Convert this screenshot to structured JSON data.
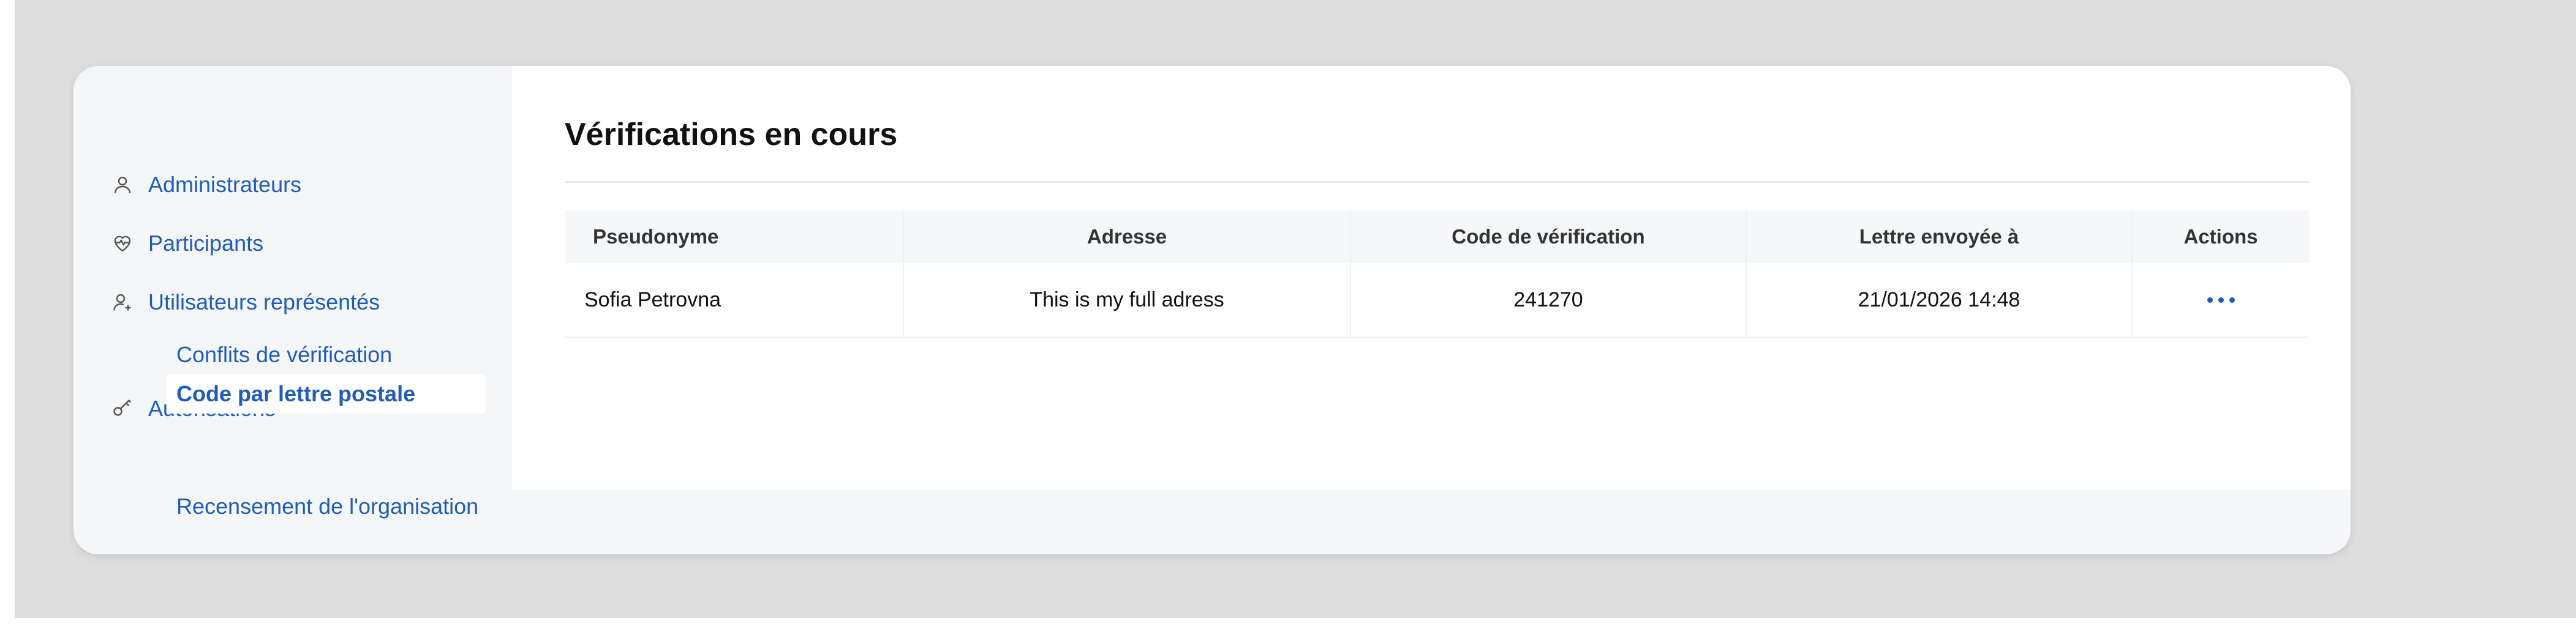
{
  "sidebar": {
    "items": [
      {
        "label": "Administrateurs",
        "icon": "user-icon"
      },
      {
        "label": "Participants",
        "icon": "heart-pulse-icon"
      },
      {
        "label": "Utilisateurs représentés",
        "icon": "user-plus-icon"
      },
      {
        "label": "Conflits de vérification"
      },
      {
        "label": "Autorisations",
        "icon": "key-icon"
      },
      {
        "label": "Code par lettre postale",
        "active": true
      },
      {
        "label": "Recensement de l'organisation"
      }
    ],
    "link_color": "#1f5cb8"
  },
  "main": {
    "title": "Vérifications en cours",
    "table": {
      "headers": [
        "Pseudonyme",
        "Adresse",
        "Code de vérification",
        "Lettre envoyée à",
        "Actions"
      ],
      "rows": [
        {
          "pseudonyme": "Sofia Petrovna",
          "adresse": "This is my full adress",
          "code": "241270",
          "lettre": "21/01/2026 14:48",
          "actions_icon": "more-horizontal-icon"
        }
      ]
    }
  }
}
